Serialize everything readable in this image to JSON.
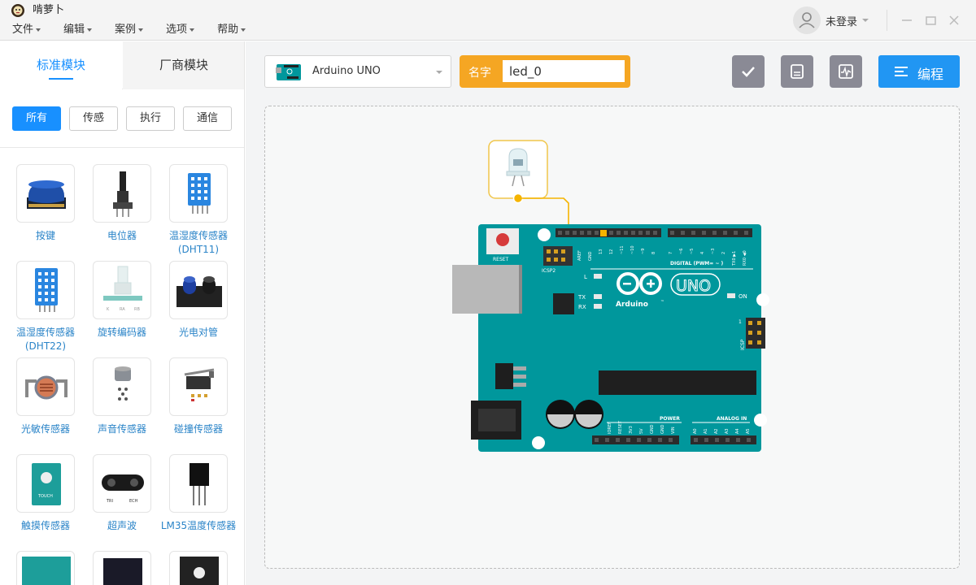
{
  "app": {
    "title": "啃萝卜",
    "logo_icon": "robot-logo-icon"
  },
  "menu": [
    "文件",
    "编辑",
    "案例",
    "选项",
    "帮助"
  ],
  "user": {
    "name": "未登录",
    "avatar_icon": "user-avatar-icon"
  },
  "window_controls": [
    "minimize-icon",
    "maximize-icon",
    "close-icon"
  ],
  "sidebar": {
    "tabs": [
      {
        "label": "标准模块",
        "active": true
      },
      {
        "label": "厂商模块",
        "active": false
      }
    ],
    "filters": [
      {
        "label": "所有",
        "active": true
      },
      {
        "label": "传感"
      },
      {
        "label": "执行"
      },
      {
        "label": "通信"
      }
    ],
    "modules": [
      {
        "label": "按键",
        "icon": "button-module-icon"
      },
      {
        "label": "电位器",
        "icon": "potentiometer-module-icon"
      },
      {
        "label": "温湿度传感器(DHT11)",
        "icon": "dht11-module-icon"
      },
      {
        "label": "温湿度传感器(DHT22)",
        "icon": "dht22-module-icon"
      },
      {
        "label": "旋转编码器",
        "icon": "rotary-encoder-module-icon"
      },
      {
        "label": "光电对管",
        "icon": "photoelectric-module-icon"
      },
      {
        "label": "光敏传感器",
        "icon": "light-sensor-module-icon"
      },
      {
        "label": "声音传感器",
        "icon": "sound-sensor-module-icon"
      },
      {
        "label": "碰撞传感器",
        "icon": "collision-sensor-module-icon"
      },
      {
        "label": "触摸传感器",
        "icon": "touch-sensor-module-icon"
      },
      {
        "label": "超声波",
        "icon": "ultrasonic-module-icon"
      },
      {
        "label": "LM35温度传感器",
        "icon": "lm35-module-icon"
      }
    ],
    "module_thumb_text": {
      "encoder_pins": [
        "K",
        "RA",
        "RB"
      ],
      "touch": "TOUCH",
      "ultrasonic": [
        "TRI",
        "ECH"
      ]
    }
  },
  "toolbar": {
    "board": {
      "name": "Arduino UNO",
      "icon": "arduino-board-icon"
    },
    "name_field": {
      "label": "名字",
      "value": "led_0"
    },
    "tools": [
      "check-icon",
      "save-icon",
      "serial-monitor-icon"
    ],
    "program_button": {
      "label": "编程",
      "icon": "list-icon"
    }
  },
  "board_labels": {
    "reset": "RESET",
    "icsp2": "ICSP2",
    "aref": "AREF",
    "gnd": "GND",
    "digital": "DIGITAL (PWM= ~ )",
    "dpins": [
      "13",
      "12",
      "~11",
      "~10",
      "~9",
      "8",
      "7",
      "~6",
      "~5",
      "4",
      "~3",
      "2",
      "TX0 ▶1",
      "RX0 ◀0"
    ],
    "l": "L",
    "tx": "TX",
    "rx": "RX",
    "on": "ON",
    "brand": "Arduino",
    "tm": "™",
    "uno": "UNO",
    "icsp": "ICSP",
    "icsp_1": "1",
    "power": "POWER",
    "analog": "ANALOG IN",
    "ppins": [
      "IOREF",
      "RESET",
      "3V3",
      "5V",
      "GND",
      "GND",
      "VIN"
    ],
    "apins": [
      "A0",
      "A1",
      "A2",
      "A3",
      "A4",
      "A5"
    ]
  },
  "colors": {
    "accent": "#1890ff",
    "name_box": "#f5a623",
    "board": "#00979c",
    "wire": "#f5b400"
  }
}
